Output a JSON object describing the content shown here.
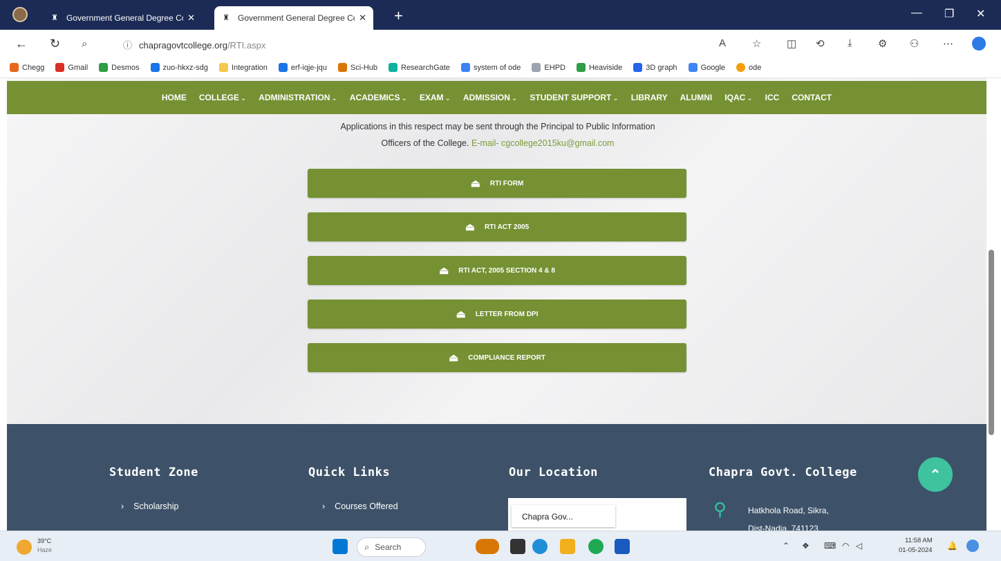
{
  "browser": {
    "tabs": [
      {
        "title": "Government General Degree Co"
      },
      {
        "title": "Government General Degree Co"
      }
    ],
    "new_tab": "+",
    "url_domain": "chapragovtcollege.org",
    "url_path": "/RTI.aspx",
    "bookmarks": [
      {
        "label": "Chegg",
        "color": "#e8671c"
      },
      {
        "label": "Gmail",
        "color": "#d93025"
      },
      {
        "label": "Desmos",
        "color": "#2f9e44"
      },
      {
        "label": "zuo-hkxz-sdg",
        "color": "#1a73e8"
      },
      {
        "label": "Integration",
        "color": "#f2c94c"
      },
      {
        "label": "erf-iqje-jqu",
        "color": "#1a73e8"
      },
      {
        "label": "Sci-Hub",
        "color": "#d97706"
      },
      {
        "label": "ResearchGate",
        "color": "#0cb3a0"
      },
      {
        "label": "system of ode",
        "color": "#3b82f6"
      },
      {
        "label": "EHPD",
        "color": "#9ca3af"
      },
      {
        "label": "Heaviside",
        "color": "#2f9e44"
      },
      {
        "label": "3D graph",
        "color": "#2563eb"
      },
      {
        "label": "Google",
        "color": "#4285f4"
      },
      {
        "label": "ode",
        "color": "#f59e0b"
      }
    ]
  },
  "site": {
    "nav": [
      {
        "label": "HOME",
        "dropdown": false
      },
      {
        "label": "COLLEGE",
        "dropdown": true
      },
      {
        "label": "ADMINISTRATION",
        "dropdown": true
      },
      {
        "label": "ACADEMICS",
        "dropdown": true
      },
      {
        "label": "EXAM",
        "dropdown": true
      },
      {
        "label": "ADMISSION",
        "dropdown": true
      },
      {
        "label": "STUDENT SUPPORT",
        "dropdown": true
      },
      {
        "label": "LIBRARY",
        "dropdown": false
      },
      {
        "label": "ALUMNI",
        "dropdown": false
      },
      {
        "label": "IQAC",
        "dropdown": true
      },
      {
        "label": "ICC",
        "dropdown": false
      },
      {
        "label": "CONTACT",
        "dropdown": false
      }
    ],
    "info_text_line1": "Applications in this respect may be sent through the Principal to Public Information",
    "info_text_line2": "Officers of the College.",
    "info_email": "E-mail- cgcollege2015ku@gmail.com",
    "downloads": [
      {
        "label": "RTI FORM"
      },
      {
        "label": "RTI ACT 2005"
      },
      {
        "label": "RTI ACT, 2005 SECTION 4 & 8"
      },
      {
        "label": "LETTER FROM DPI"
      },
      {
        "label": "COMPLIANCE REPORT"
      }
    ],
    "accent_color": "#759133",
    "footer": {
      "student_zone_title": "Student Zone",
      "student_zone_link": "Scholarship",
      "quick_links_title": "Quick Links",
      "quick_links_link": "Courses Offered",
      "location_title": "Our Location",
      "map_label": "Chapra Gov...",
      "college_title": "Chapra Govt. College",
      "address_line1": "Hatkhola Road, Sikra,",
      "address_line2": "Dist-Nadia, 741123"
    }
  },
  "taskbar": {
    "weather_temp": "39°C",
    "weather_desc": "Haze",
    "search_placeholder": "Search",
    "time": "11:58 AM",
    "date": "01-05-2024"
  }
}
